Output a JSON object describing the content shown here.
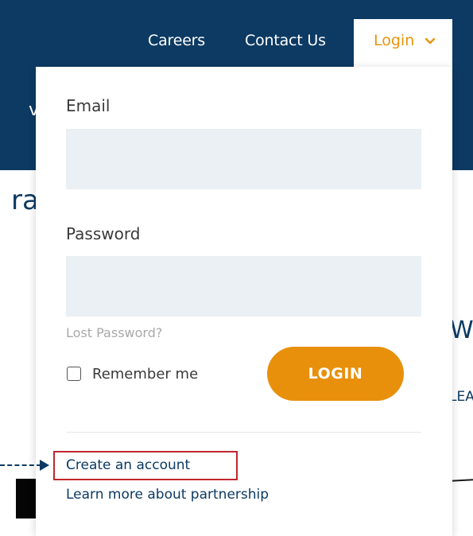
{
  "nav": {
    "careers": "Careers",
    "contact": "Contact Us",
    "login": "Login",
    "login_icon": "chevron-down-icon"
  },
  "background_fragments": {
    "a": "v",
    "b": "ra",
    "w": "W",
    "ea": "LEA"
  },
  "login_form": {
    "email_label": "Email",
    "email_value": "",
    "password_label": "Password",
    "password_value": "",
    "lost_password": "Lost Password?",
    "remember_me": "Remember me",
    "remember_checked": false,
    "login_button": "LOGIN",
    "create_account": "Create an account",
    "partnership": "Learn more about partnership"
  },
  "colors": {
    "navy": "#0c3a63",
    "accent_orange": "#e8900c",
    "highlight_red": "#c0272d",
    "input_bg": "#eaf0f3"
  }
}
